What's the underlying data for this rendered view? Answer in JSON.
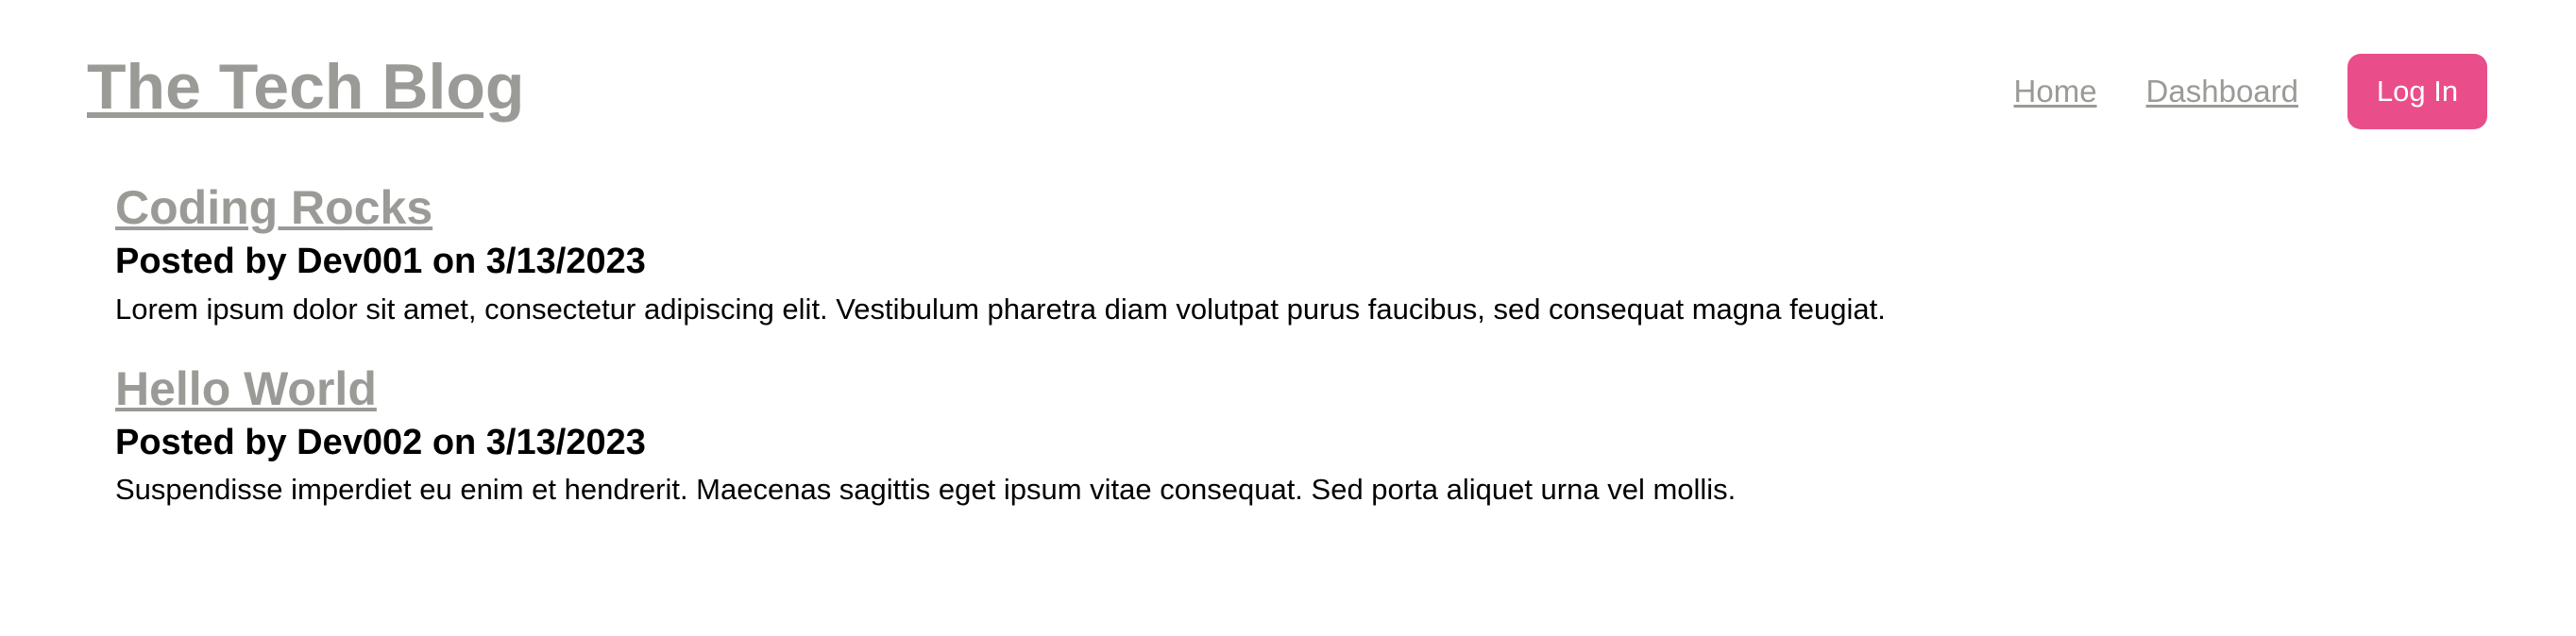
{
  "header": {
    "site_title": "The Tech Blog",
    "nav": {
      "home_label": "Home",
      "dashboard_label": "Dashboard",
      "login_label": "Log In"
    }
  },
  "posts": [
    {
      "title": "Coding Rocks",
      "meta": "Posted by Dev001 on 3/13/2023",
      "body": "Lorem ipsum dolor sit amet, consectetur adipiscing elit. Vestibulum pharetra diam volutpat purus faucibus, sed consequat magna feugiat."
    },
    {
      "title": "Hello World",
      "meta": "Posted by Dev002 on 3/13/2023",
      "body": "Suspendisse imperdiet eu enim et hendrerit. Maecenas sagittis eget ipsum vitae consequat. Sed porta aliquet urna vel mollis."
    }
  ],
  "colors": {
    "link_gray": "#9a9b97",
    "accent_pink": "#e94e8a",
    "text": "#000000",
    "background": "#ffffff"
  }
}
